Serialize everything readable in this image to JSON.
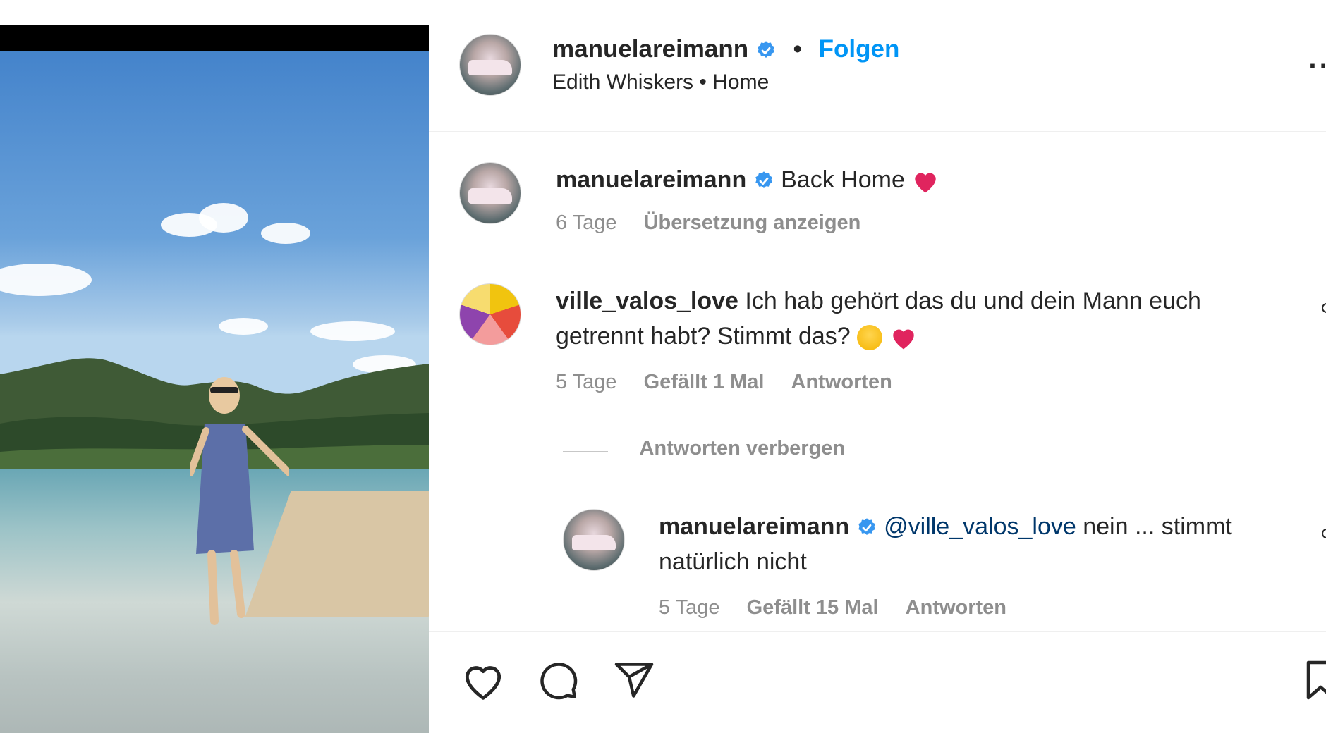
{
  "post_header": {
    "username": "manuelareimann",
    "follow_label": "Folgen",
    "audio": "Edith Whiskers",
    "location": "Home"
  },
  "caption": {
    "username": "manuelareimann",
    "text": "Back Home",
    "age": "6 Tage",
    "translate_label": "Übersetzung anzeigen"
  },
  "comments": [
    {
      "username": "ville_valos_love",
      "text": "Ich hab gehört das du und dein Mann euch getrennt habt? Stimmt das?",
      "age": "5 Tage",
      "likes": "Gefällt 1 Mal",
      "reply_label": "Antworten",
      "hide_replies_label": "Antworten verbergen",
      "replies": [
        {
          "username": "manuelareimann",
          "mention": "@ville_valos_love",
          "text": "nein ... stimmt natürlich nicht",
          "age": "5 Tage",
          "likes": "Gefällt 15 Mal",
          "reply_label": "Antworten"
        }
      ]
    }
  ],
  "actions": {
    "icons": [
      "heart-icon",
      "comment-icon",
      "share-icon",
      "bookmark-icon"
    ]
  },
  "colors": {
    "follow": "#0095f6",
    "verified": "#3897f0",
    "heart": "#e0245e",
    "meta": "#8e8e8e",
    "mention": "#00376b"
  }
}
